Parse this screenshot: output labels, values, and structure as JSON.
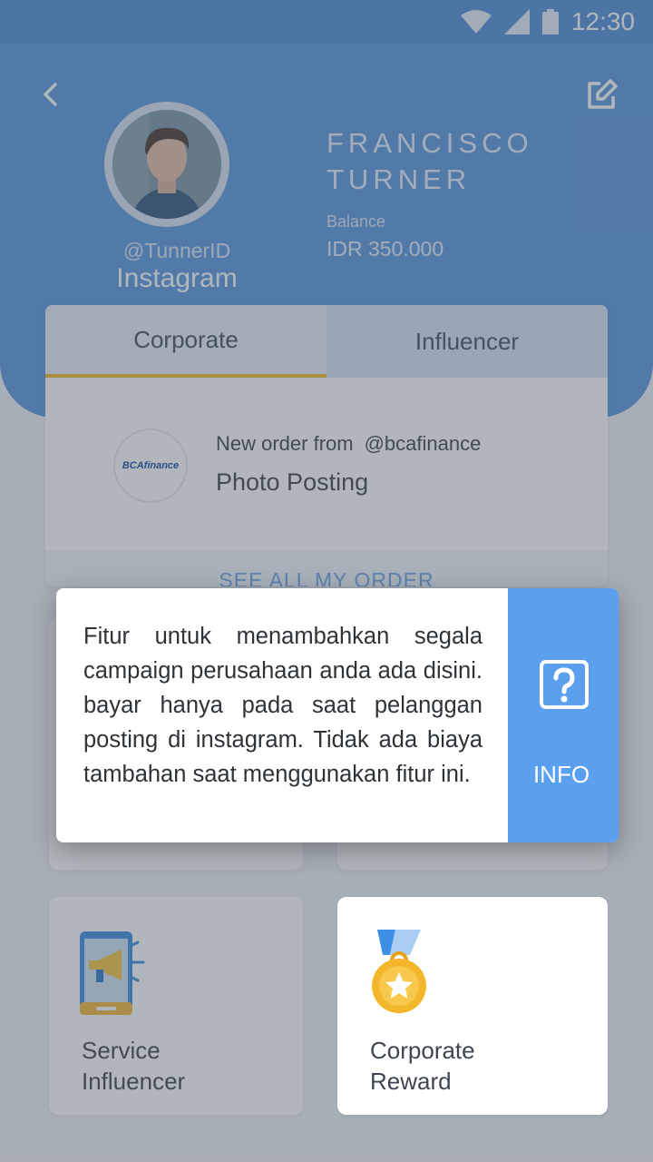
{
  "status_bar": {
    "time": "12:30"
  },
  "profile": {
    "name_line1": "FRANCISCO",
    "name_line2": "TURNER",
    "handle": "@TunnerID",
    "platform": "Instagram",
    "balance_label": "Balance",
    "balance_value": "IDR 350.000"
  },
  "tabs": [
    {
      "label": "Corporate",
      "active": true
    },
    {
      "label": "Influencer",
      "active": false
    }
  ],
  "order": {
    "logo_text": "BCAfinance",
    "prefix": "New order from",
    "from": "@bcafinance",
    "type": "Photo Posting",
    "see_all": "SEE ALL MY ORDER"
  },
  "cards": [
    {
      "label_line1": "Service",
      "label_line2": "Influencer",
      "icon": "megaphone-phone-icon"
    },
    {
      "label_line1": "Corporate",
      "label_line2": "Reward",
      "icon": "medal-icon"
    }
  ],
  "info_popup": {
    "text": "Fitur untuk menambahkan segala campaign perusahaan anda ada disini. bayar hanya pada saat pelanggan posting di instagram. Tidak ada biaya tambahan saat menggunakan fitur ini.",
    "label": "INFO",
    "icon": "question-icon"
  },
  "colors": {
    "primary": "#5c98dd",
    "accent": "#f0bd2f",
    "info": "#5ba0ef"
  }
}
